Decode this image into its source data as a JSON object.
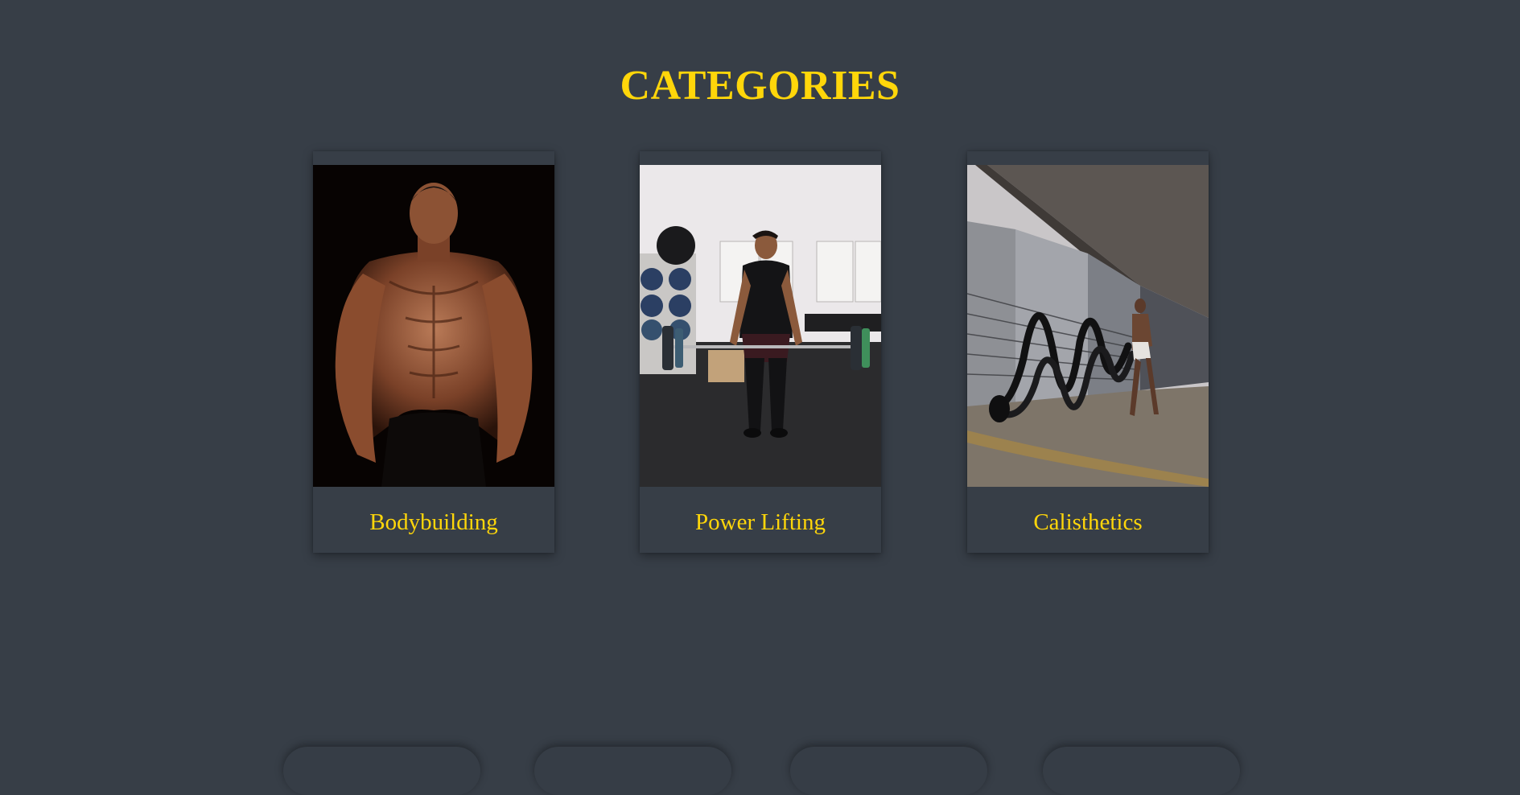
{
  "colors": {
    "background": "#373e47",
    "accent": "#ffd60a"
  },
  "section": {
    "title": "CATEGORIES"
  },
  "categories": [
    {
      "label": "Bodybuilding",
      "image": "bodybuilder-photo"
    },
    {
      "label": "Power Lifting",
      "image": "deadlift-photo"
    },
    {
      "label": "Calisthetics",
      "image": "battle-ropes-photo"
    }
  ]
}
